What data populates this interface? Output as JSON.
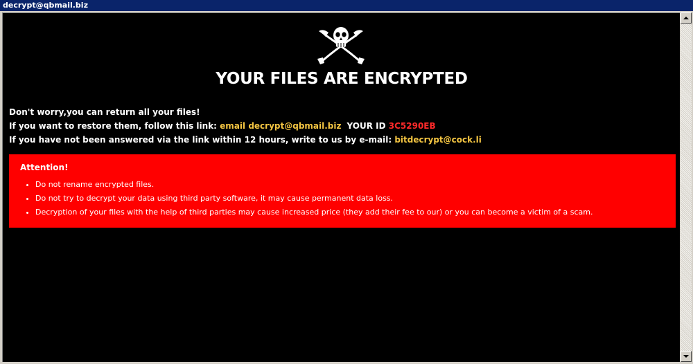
{
  "window": {
    "title": "decrypt@qbmail.biz"
  },
  "logo": {
    "icon": "skull-crossed-swords-icon"
  },
  "headline": "YOUR FILES ARE ENCRYPTED",
  "lines": {
    "line1": "Don't worry,you can return all your files!",
    "line2_prefix": "If you want to restore them, follow this link: ",
    "line2_email": "email decrypt@qbmail.biz",
    "line2_id_label": "YOUR ID",
    "line2_id_value": "3C5290EB",
    "line3_prefix": "If you have not been answered via the link within 12 hours, write to us by e-mail: ",
    "line3_email": "bitdecrypt@cock.li"
  },
  "attention": {
    "title": "Attention!",
    "items": [
      "Do not rename encrypted files.",
      "Do not try to decrypt your data using third party software, it may cause permanent data loss.",
      "Decryption of your files with the help of third parties may cause increased price (they add their fee to our) or you can become a victim of a scam."
    ]
  },
  "colors": {
    "background": "#000000",
    "highlight": "#f4c542",
    "id_color": "#ff2a2a",
    "attention_box": "#ff0000",
    "titlebar": "#0a246a"
  }
}
